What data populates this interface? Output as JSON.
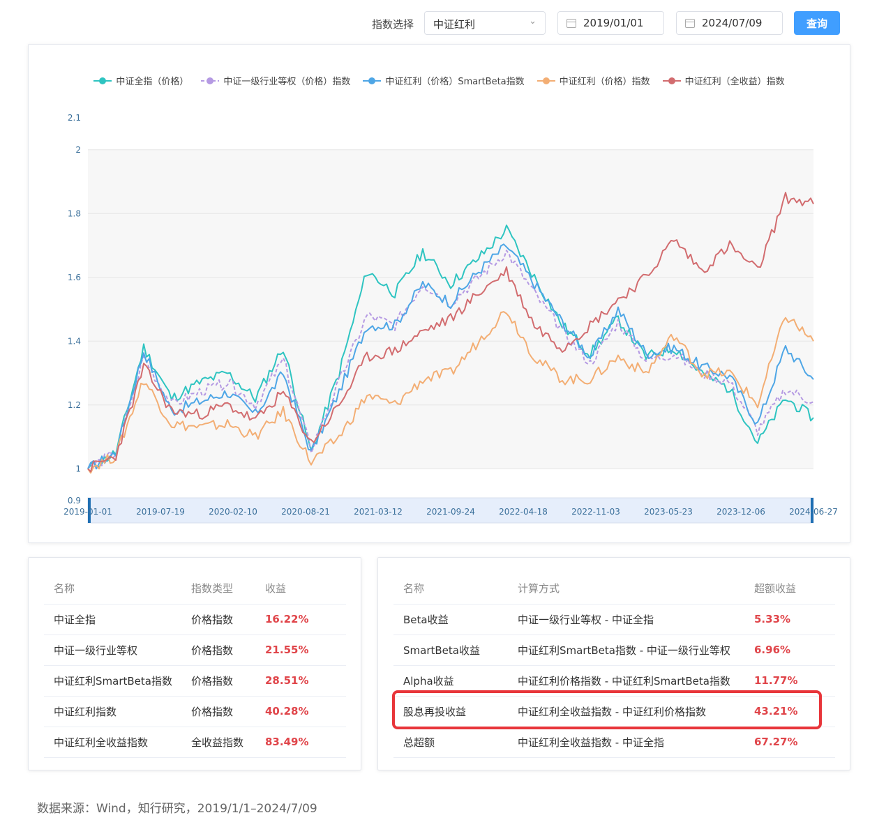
{
  "toolbar": {
    "index_label": "指数选择",
    "index_value": "中证红利",
    "start_date": "2019/01/01",
    "end_date": "2024/07/09",
    "query_label": "查询"
  },
  "chart_data": {
    "type": "line",
    "title": "",
    "xlabel": "",
    "ylabel": "",
    "ylim": [
      0.9,
      2.1
    ],
    "yticks": [
      0.9,
      1,
      1.2,
      1.4,
      1.6,
      1.8,
      2,
      2.1
    ],
    "xticks": [
      "2019-01-01",
      "2019-07-19",
      "2020-02-10",
      "2020-08-21",
      "2021-03-12",
      "2021-09-24",
      "2022-04-18",
      "2022-11-03",
      "2023-05-23",
      "2023-12-06",
      "2024-06-27"
    ],
    "grid": true,
    "legend": "top",
    "series": [
      {
        "name": "中证全指（价格）",
        "color": "#2ec4c1",
        "dashed": false,
        "values": [
          1.0,
          1.05,
          1.38,
          1.22,
          1.27,
          1.3,
          1.22,
          1.38,
          1.05,
          1.3,
          1.62,
          1.55,
          1.68,
          1.58,
          1.66,
          1.75,
          1.6,
          1.45,
          1.36,
          1.47,
          1.35,
          1.38,
          1.3,
          1.25,
          1.08,
          1.22,
          1.16
        ]
      },
      {
        "name": "中证一级行业等权（价格）指数",
        "color": "#b59ae3",
        "dashed": true,
        "values": [
          1.0,
          1.05,
          1.35,
          1.2,
          1.24,
          1.27,
          1.2,
          1.34,
          1.06,
          1.27,
          1.48,
          1.45,
          1.58,
          1.52,
          1.6,
          1.68,
          1.55,
          1.43,
          1.33,
          1.46,
          1.34,
          1.36,
          1.3,
          1.27,
          1.12,
          1.25,
          1.21
        ]
      },
      {
        "name": "中证红利（价格）SmartBeta指数",
        "color": "#4ea6e6",
        "dashed": false,
        "values": [
          1.0,
          1.05,
          1.37,
          1.18,
          1.21,
          1.24,
          1.17,
          1.3,
          1.05,
          1.24,
          1.45,
          1.45,
          1.58,
          1.52,
          1.62,
          1.7,
          1.58,
          1.46,
          1.35,
          1.5,
          1.36,
          1.38,
          1.32,
          1.29,
          1.14,
          1.38,
          1.28
        ]
      },
      {
        "name": "中证红利（价格）指数",
        "color": "#f3ae74",
        "dashed": false,
        "values": [
          1.0,
          1.04,
          1.28,
          1.14,
          1.13,
          1.14,
          1.1,
          1.18,
          1.02,
          1.1,
          1.23,
          1.2,
          1.28,
          1.3,
          1.4,
          1.5,
          1.35,
          1.28,
          1.28,
          1.35,
          1.3,
          1.42,
          1.3,
          1.3,
          1.2,
          1.48,
          1.4
        ]
      },
      {
        "name": "中证红利（全收益）指数",
        "color": "#d26c6f",
        "dashed": false,
        "values": [
          1.0,
          1.04,
          1.32,
          1.18,
          1.17,
          1.2,
          1.15,
          1.24,
          1.08,
          1.2,
          1.35,
          1.37,
          1.43,
          1.47,
          1.55,
          1.62,
          1.45,
          1.38,
          1.45,
          1.53,
          1.6,
          1.72,
          1.62,
          1.7,
          1.62,
          1.85,
          1.83
        ]
      }
    ]
  },
  "left_table": {
    "headers": [
      "名称",
      "指数类型",
      "收益"
    ],
    "rows": [
      [
        "中证全指",
        "价格指数",
        "16.22%"
      ],
      [
        "中证一级行业等权",
        "价格指数",
        "21.55%"
      ],
      [
        "中证红利SmartBeta指数",
        "价格指数",
        "28.51%"
      ],
      [
        "中证红利指数",
        "价格指数",
        "40.28%"
      ],
      [
        "中证红利全收益指数",
        "全收益指数",
        "83.49%"
      ]
    ]
  },
  "right_table": {
    "headers": [
      "名称",
      "计算方式",
      "超额收益"
    ],
    "rows": [
      [
        "Beta收益",
        "中证一级行业等权 - 中证全指",
        "5.33%"
      ],
      [
        "SmartBeta收益",
        "中证红利SmartBeta指数 - 中证一级行业等权",
        "6.96%"
      ],
      [
        "Alpha收益",
        "中证红利价格指数 - 中证红利SmartBeta指数",
        "11.77%"
      ],
      [
        "股息再投收益",
        "中证红利全收益指数 - 中证红利价格指数",
        "43.21%"
      ],
      [
        "总超额",
        "中证红利全收益指数 - 中证全指",
        "67.27%"
      ]
    ]
  },
  "source": "数据来源：Wind，知行研究，2019/1/1–2024/7/09",
  "highlight_color": "#e8353a",
  "accent_color": "#409eff"
}
